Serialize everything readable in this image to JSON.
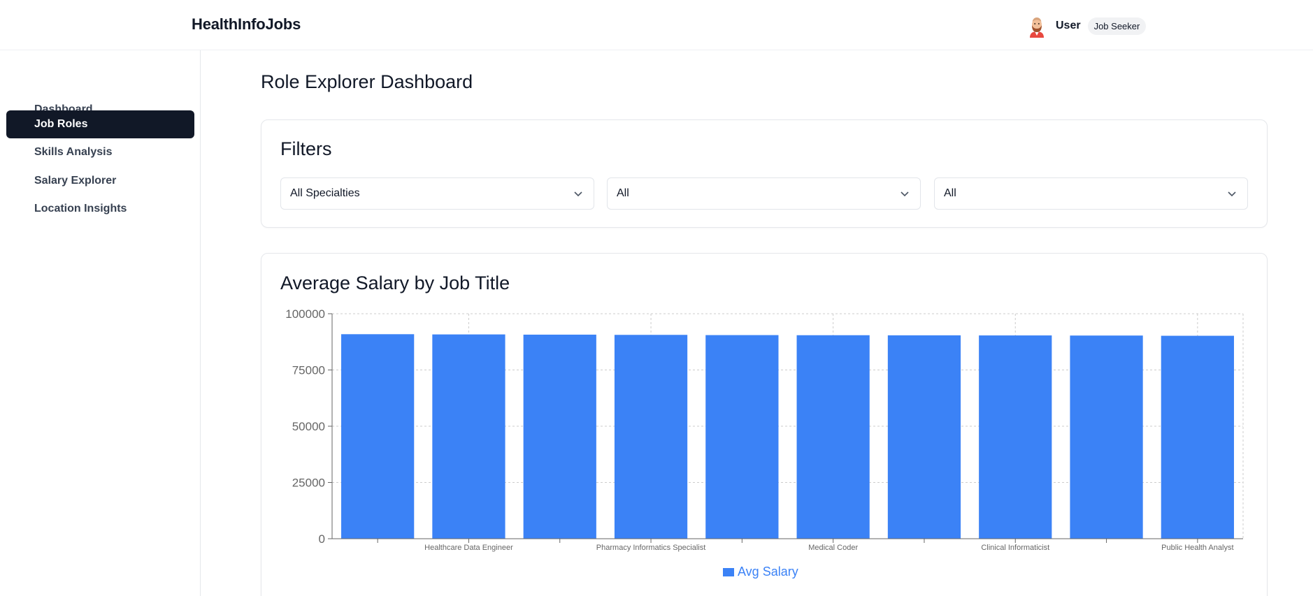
{
  "header": {
    "brand": "HealthInfoJobs",
    "user_name": "User",
    "user_role": "Job Seeker",
    "avatar_icon": "user-avatar-icon"
  },
  "sidebar": {
    "items": [
      {
        "label": "Dashboard",
        "active": false
      },
      {
        "label": "Job Roles",
        "active": true
      },
      {
        "label": "Skills Analysis",
        "active": false
      },
      {
        "label": "Salary Explorer",
        "active": false
      },
      {
        "label": "Location Insights",
        "active": false
      }
    ]
  },
  "main": {
    "title": "Role Explorer Dashboard",
    "filters": {
      "title": "Filters",
      "selects": [
        {
          "value": "All Specialties"
        },
        {
          "value": "All"
        },
        {
          "value": "All"
        }
      ]
    },
    "chart_card": {
      "title": "Average Salary by Job Title"
    }
  },
  "colors": {
    "accent": "#3b82f6",
    "nav_active_bg": "#111827",
    "grid": "#cccccc"
  },
  "chart_data": {
    "type": "bar",
    "title": "Average Salary by Job Title",
    "categories": [
      "",
      "Healthcare Data Engineer",
      "",
      "Pharmacy Informatics Specialist",
      "",
      "Medical Coder",
      "",
      "Clinical Informaticist",
      "",
      "Public Health Analyst"
    ],
    "series": [
      {
        "name": "Avg Salary",
        "values": [
          90900,
          90800,
          90700,
          90600,
          90500,
          90450,
          90400,
          90350,
          90300,
          90200
        ]
      }
    ],
    "ylim": [
      0,
      100000
    ],
    "yticks": [
      0,
      25000,
      50000,
      75000,
      100000
    ],
    "grid": true,
    "legend": "bottom"
  }
}
